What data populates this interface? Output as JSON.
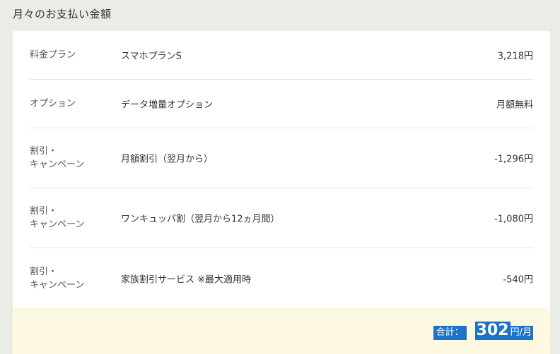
{
  "section": {
    "title": "月々のお支払い金額"
  },
  "rows": [
    {
      "label": [
        "料金プラン"
      ],
      "name": "スマホプランS",
      "price": "3,218円"
    },
    {
      "label": [
        "オプション"
      ],
      "name": "データ増量オプション",
      "price": "月額無料"
    },
    {
      "label": [
        "割引・",
        "キャンペーン"
      ],
      "name": "月額割引（翌月から）",
      "price": "-1,296円"
    },
    {
      "label": [
        "割引・",
        "キャンペーン"
      ],
      "name": "ワンキュッパ割（翌月から12ヵ月間）",
      "price": "-1,080円"
    },
    {
      "label": [
        "割引・",
        "キャンペーン"
      ],
      "name": "家族割引サービス ※最大適用時",
      "price": "-540円"
    }
  ],
  "total": {
    "label": "合計：",
    "amount": "302",
    "unit": "円/月"
  },
  "colors": {
    "page_background": "#ecece6",
    "card_background": "#ffffff",
    "total_background": "#fdf8e1",
    "selection_highlight": "#1e73c8"
  }
}
